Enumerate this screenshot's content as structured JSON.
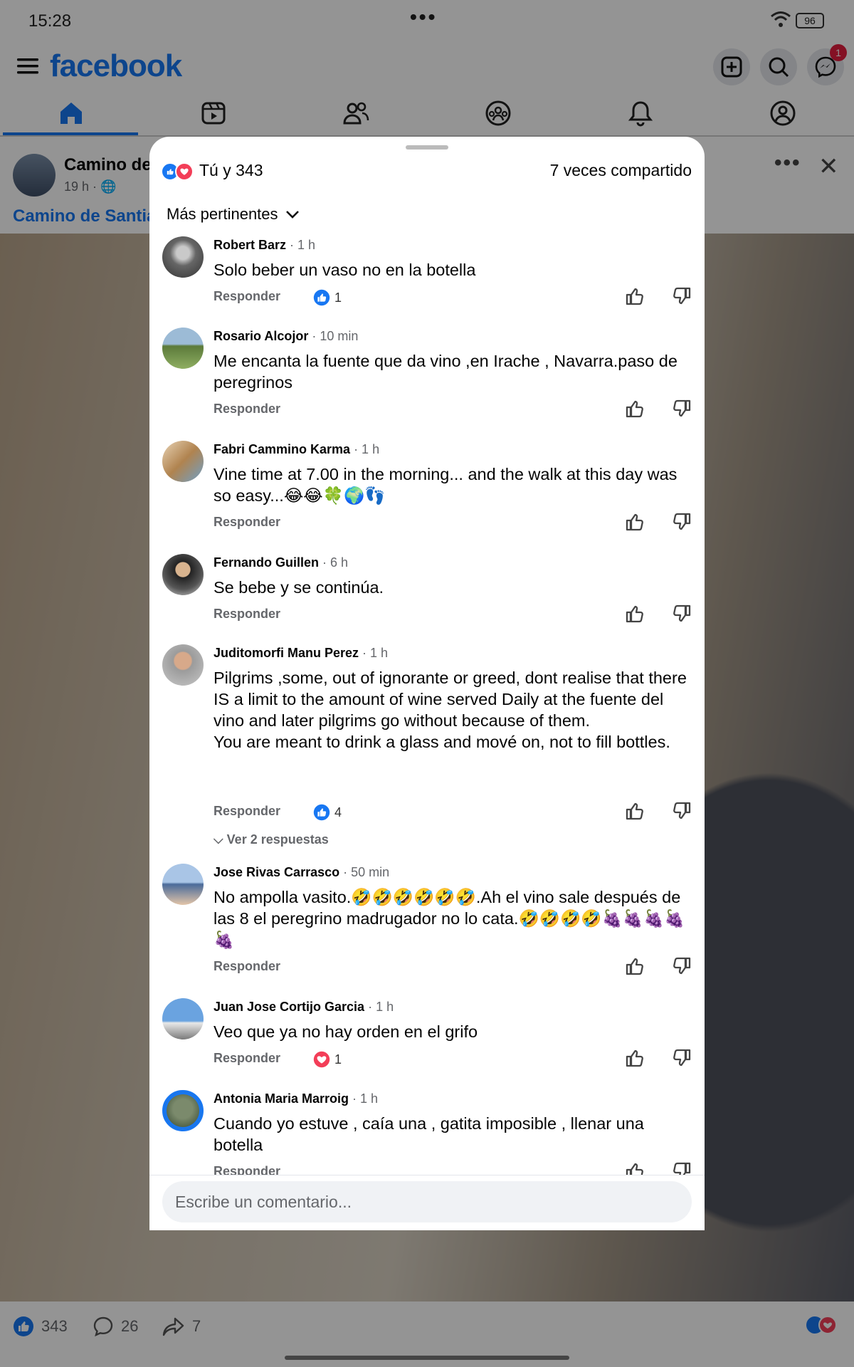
{
  "status": {
    "time": "15:28",
    "battery": "96",
    "dots": "•••"
  },
  "header": {
    "logo": "facebook",
    "messenger_badge": "1"
  },
  "tabs": [
    {
      "icon": "home-icon"
    },
    {
      "icon": "video-icon"
    },
    {
      "icon": "friends-icon"
    },
    {
      "icon": "groups-icon"
    },
    {
      "icon": "notifications-icon"
    },
    {
      "icon": "profile-icon"
    }
  ],
  "post": {
    "name": "Camino de",
    "meta": "19 h ·",
    "link": "Camino de Santiag",
    "likes": "343",
    "comments": "26",
    "shares": "7"
  },
  "sheet": {
    "reactions": "Tú y 343",
    "shares": "7 veces compartido",
    "sort": "Más pertinentes",
    "reply_label": "Responder",
    "input_placeholder": "Escribe un comentario..."
  },
  "comments": [
    {
      "name": "Robert Barz",
      "time": " · 1 h",
      "text": "Solo beber un vaso no en la botella",
      "reaction": "like",
      "count": "1"
    },
    {
      "name": "Rosario Alcojor",
      "time": " · 10 min",
      "text": "Me encanta la fuente que da vino ,en Irache , Navarra.paso de peregrinos",
      "reaction": "",
      "count": ""
    },
    {
      "name": "Fabri Cammino Karma",
      "time": " · 1 h",
      "text": "Vine time at 7.00 in the morning... and the walk at this day was so easy...😂😂🍀🌍👣",
      "reaction": "",
      "count": ""
    },
    {
      "name": "Fernando Guillen",
      "time": " · 6 h",
      "text": "Se bebe y se continúa.",
      "reaction": "",
      "count": ""
    },
    {
      "name": "Juditomorfi Manu Perez",
      "time": " · 1 h",
      "text": "Pilgrims ,some, out of ignorante or greed, dont realise that there IS a limit to the amount of wine served Daily at the fuente del vino and later pilgrims go without because of them.\nYou are meant to drink a glass and mové on, not to fill bottles.",
      "reaction": "like",
      "count": "4",
      "replies": "Ver 2 respuestas"
    },
    {
      "name": "Jose Rivas Carrasco",
      "time": " · 50 min",
      "text": "No ampolla vasito.🤣🤣🤣🤣🤣🤣.Ah el vino sale después de las 8 el peregrino madrugador no lo cata.🤣🤣🤣🤣🍇🍇🍇🍇🍇",
      "reaction": "",
      "count": ""
    },
    {
      "name": "Juan Jose Cortijo Garcia",
      "time": " · 1 h",
      "text": "Veo que ya no hay orden en el grifo",
      "reaction": "love",
      "count": "1"
    },
    {
      "name": "Antonia Maria Marroig",
      "time": " · 1 h",
      "text": "Cuando yo estuve , caía una , gatita imposible , llenar una botella",
      "reaction": "",
      "count": ""
    }
  ],
  "colors": {
    "brand": "#1877f2",
    "love": "#f33e58"
  }
}
